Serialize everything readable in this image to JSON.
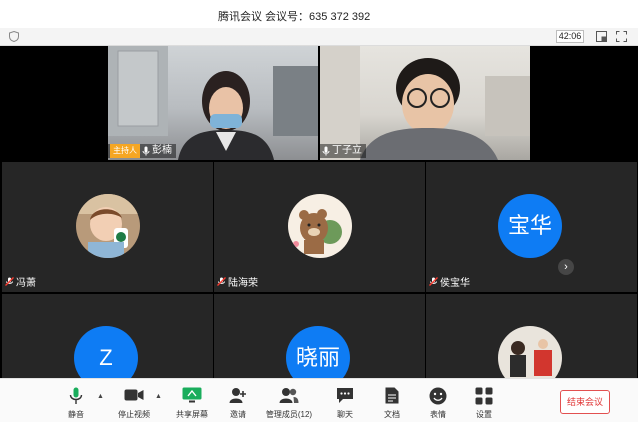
{
  "window": {
    "title": "腾讯会议  会议号：635 372 392"
  },
  "infobar": {
    "timer": "42:06"
  },
  "speakers": [
    {
      "name": "彭楠",
      "badge": "主持人"
    },
    {
      "name": "丁子立"
    }
  ],
  "participants": [
    {
      "name": "冯萧",
      "avatar": "photo-child"
    },
    {
      "name": "陆海荣",
      "avatar": "photo-bear"
    },
    {
      "name": "侯宝华",
      "avatar_text": "宝华"
    },
    {
      "name": "",
      "avatar_text": "Z"
    },
    {
      "name": "",
      "avatar_text": "晓丽"
    },
    {
      "name": "",
      "avatar": "photo-people"
    }
  ],
  "toolbar": {
    "mute": "静音",
    "stop_video": "停止视频",
    "share_screen": "共享屏幕",
    "invite": "邀请",
    "manage_members": "管理成员(12)",
    "chat": "聊天",
    "documents": "文档",
    "emoji": "表情",
    "settings": "设置",
    "end_meeting": "结束会议"
  },
  "colors": {
    "accent": "#0e7cf4",
    "host_badge": "#f5a623",
    "end_button": "#e03535",
    "share_icon": "#1aad5c"
  }
}
